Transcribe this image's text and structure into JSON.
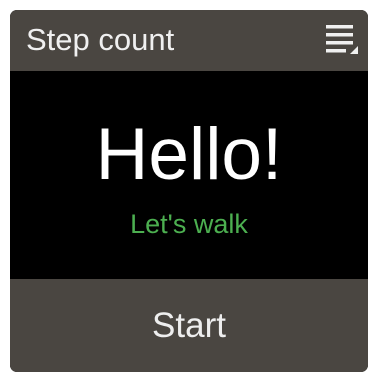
{
  "header": {
    "title": "Step count",
    "menu_icon": "menu-icon"
  },
  "main": {
    "greeting": "Hello!",
    "subtitle": "Let's walk"
  },
  "footer": {
    "start_label": "Start"
  },
  "colors": {
    "bar_background": "#4a4641",
    "screen_background": "#000000",
    "accent_green": "#4caf50",
    "text_light": "#f0f0f0"
  }
}
